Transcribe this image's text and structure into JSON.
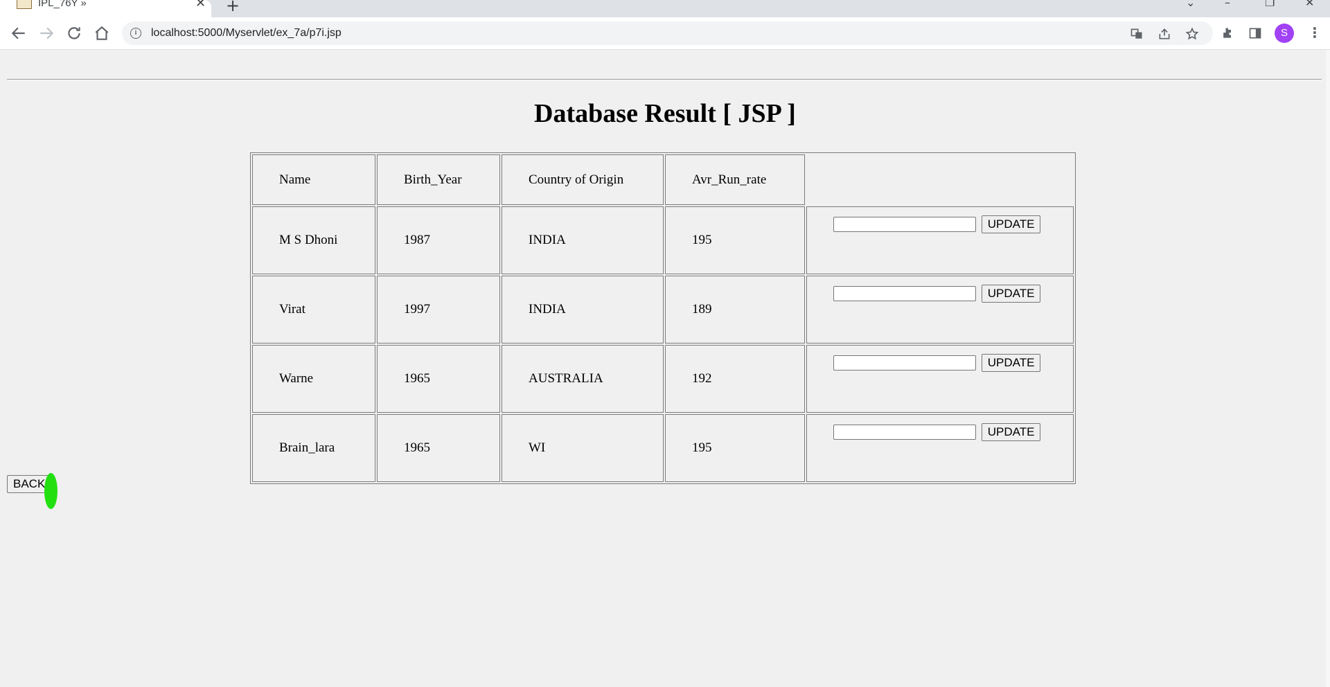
{
  "browser": {
    "tab_title": "IPL_76Y »",
    "tab_close": "✕",
    "new_tab": "+",
    "url": "localhost:5000/Myservlet/ex_7a/p7i.jsp",
    "avatar_letter": "S",
    "icons": [
      "back-icon",
      "forward-icon",
      "reload-icon",
      "home-icon",
      "info-icon",
      "translate-icon",
      "share-icon",
      "star-icon",
      "extensions-icon",
      "side-panel-icon",
      "more-icon"
    ]
  },
  "page": {
    "title": "Database Result [ JSP ]",
    "headers": [
      "Name",
      "Birth_Year",
      "Country of Origin",
      "Avr_Run_rate"
    ],
    "rows": [
      {
        "name": "M S Dhoni",
        "birth_year": "1987",
        "country": "INDIA",
        "run_rate": "195"
      },
      {
        "name": "Virat",
        "birth_year": "1997",
        "country": "INDIA",
        "run_rate": "189"
      },
      {
        "name": "Warne",
        "birth_year": "1965",
        "country": "AUSTRALIA",
        "run_rate": "192"
      },
      {
        "name": "Brain_lara",
        "birth_year": "1965",
        "country": "WI",
        "run_rate": "195"
      }
    ],
    "update_label": "UPDATE",
    "back_label": "BACK"
  }
}
